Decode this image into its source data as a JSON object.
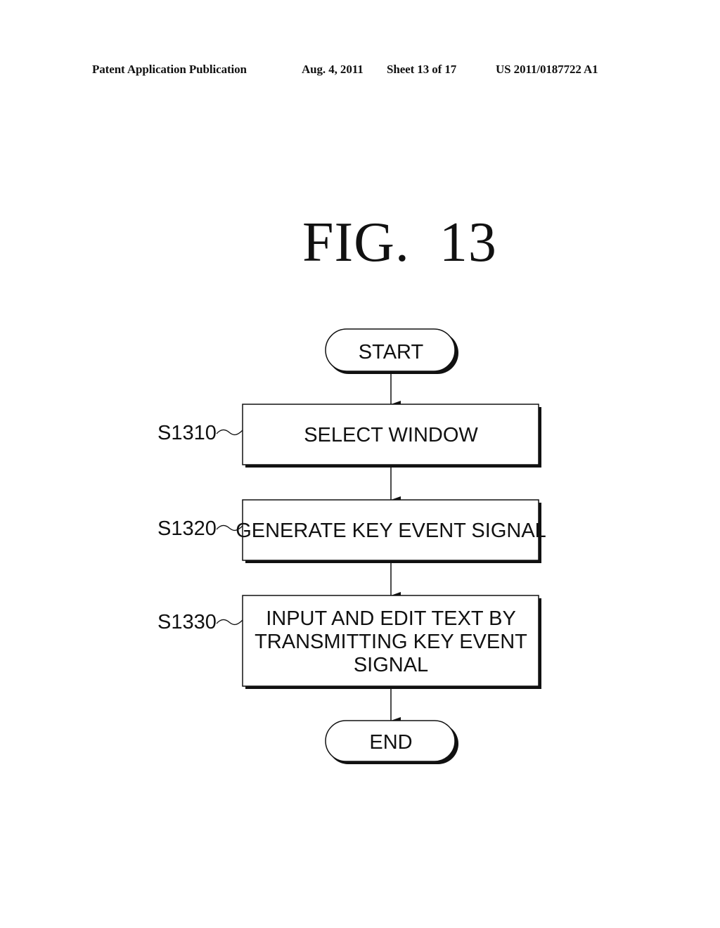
{
  "header": {
    "publication_type": "Patent Application Publication",
    "date": "Aug. 4, 2011",
    "sheet": "Sheet 13 of 17",
    "publication_number": "US 2011/0187722 A1"
  },
  "figure": {
    "title": "FIG.  13"
  },
  "flowchart": {
    "start": {
      "label": "START"
    },
    "steps": [
      {
        "id": "S1310",
        "lines": [
          "SELECT WINDOW"
        ]
      },
      {
        "id": "S1320",
        "lines": [
          "GENERATE KEY EVENT SIGNAL"
        ]
      },
      {
        "id": "S1330",
        "lines": [
          "INPUT AND EDIT TEXT BY",
          "TRANSMITTING KEY EVENT",
          "SIGNAL"
        ]
      }
    ],
    "end": {
      "label": "END"
    }
  }
}
